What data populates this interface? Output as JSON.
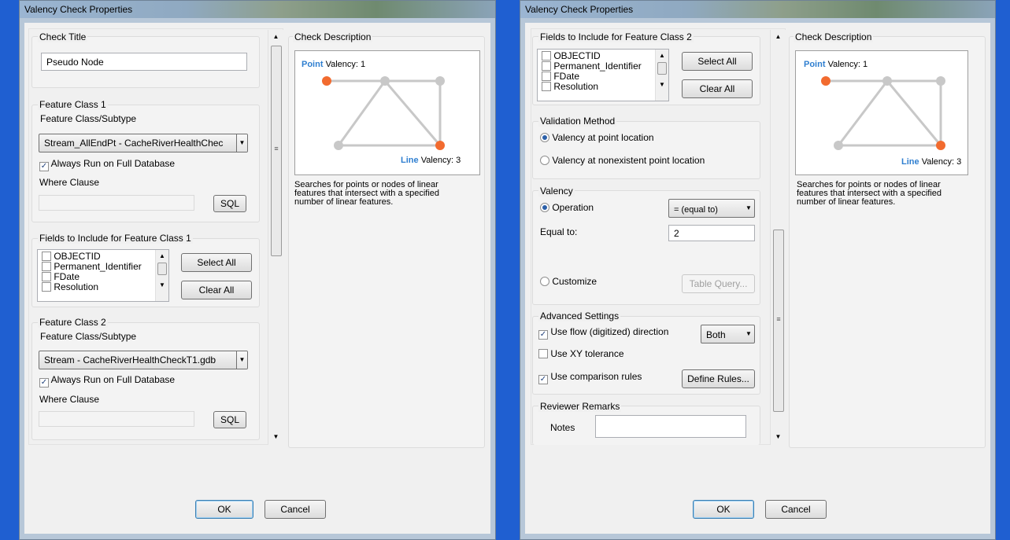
{
  "title": "Valency Check Properties",
  "buttons": {
    "ok": "OK",
    "cancel": "Cancel"
  },
  "left": {
    "check_title_label": "Check Title",
    "check_title_value": "Pseudo Node",
    "fc1": {
      "group": "Feature Class 1",
      "subtype_label": "Feature Class/Subtype",
      "subtype_value": "Stream_AllEndPt -  CacheRiverHealthChec",
      "always_run": "Always Run on Full Database",
      "where_label": "Where Clause",
      "sql": "SQL"
    },
    "fields1": {
      "group": "Fields to Include for Feature Class 1",
      "items": [
        "OBJECTID",
        "Permanent_Identifier",
        "FDate",
        "Resolution"
      ],
      "select_all": "Select All",
      "clear_all": "Clear All"
    },
    "fc2": {
      "group": "Feature Class 2",
      "subtype_label": "Feature Class/Subtype",
      "subtype_value": "Stream -  CacheRiverHealthCheckT1.gdb",
      "always_run": "Always Run on Full Database",
      "where_label": "Where Clause",
      "sql": "SQL"
    }
  },
  "right": {
    "fields2": {
      "group": "Fields to Include for Feature Class 2",
      "items": [
        "OBJECTID",
        "Permanent_Identifier",
        "FDate",
        "Resolution"
      ],
      "select_all": "Select All",
      "clear_all": "Clear All"
    },
    "validation": {
      "group": "Validation Method",
      "opt1": "Valency at point location",
      "opt2": "Valency at nonexistent point location"
    },
    "valency": {
      "group": "Valency",
      "operation": "Operation",
      "operation_value": "= (equal to)",
      "equal_label": "Equal to:",
      "equal_value": "2",
      "customize": "Customize",
      "table_query": "Table Query..."
    },
    "advanced": {
      "group": "Advanced Settings",
      "flow": "Use flow (digitized) direction",
      "flow_value": "Both",
      "xy": "Use XY tolerance",
      "comparison": "Use comparison rules",
      "define_rules": "Define Rules..."
    },
    "remarks": {
      "group": "Reviewer Remarks",
      "notes_label": "Notes",
      "notes_value": ""
    }
  },
  "description": {
    "label": "Check Description",
    "point_word": "Point",
    "point_valency": "Valency: 1",
    "line_word": "Line",
    "line_valency": "Valency: 3",
    "text": "Searches for points or nodes of linear features that intersect with a specified number of linear features."
  },
  "colors": {
    "point_orange": "#f26b2f",
    "label_blue": "#2f7fd0",
    "line_gray": "#c8c8c8",
    "divider_blue": "#1f5fd1"
  },
  "icons": [
    "checkbox-checked",
    "radio-selected",
    "dropdown-arrow",
    "scroll-arrow"
  ]
}
